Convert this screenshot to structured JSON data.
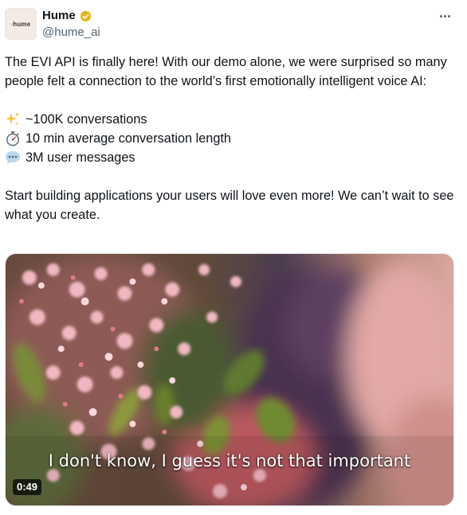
{
  "author": {
    "display_name": "Hume",
    "handle": "@hume_ai",
    "avatar_text": "hume",
    "verified_badge_color": "#e2b719"
  },
  "tweet": {
    "paragraph1": "The EVI API is finally here! With our demo alone, we were surprised so many people felt a connection to the world’s first emotionally intelligent voice AI:",
    "stats": [
      {
        "icon": "sparkles-icon",
        "text": "~100K conversations"
      },
      {
        "icon": "stopwatch-icon",
        "text": "10 min average conversation length"
      },
      {
        "icon": "speech-bubble-icon",
        "text": "3M user messages"
      }
    ],
    "paragraph2": "Start building applications your users will love even more! We can’t wait to see what you create."
  },
  "video": {
    "caption": "I don't know, I guess it's not that important",
    "duration": "0:49"
  },
  "colors": {
    "text": "#0f1419",
    "secondary": "#536471"
  }
}
